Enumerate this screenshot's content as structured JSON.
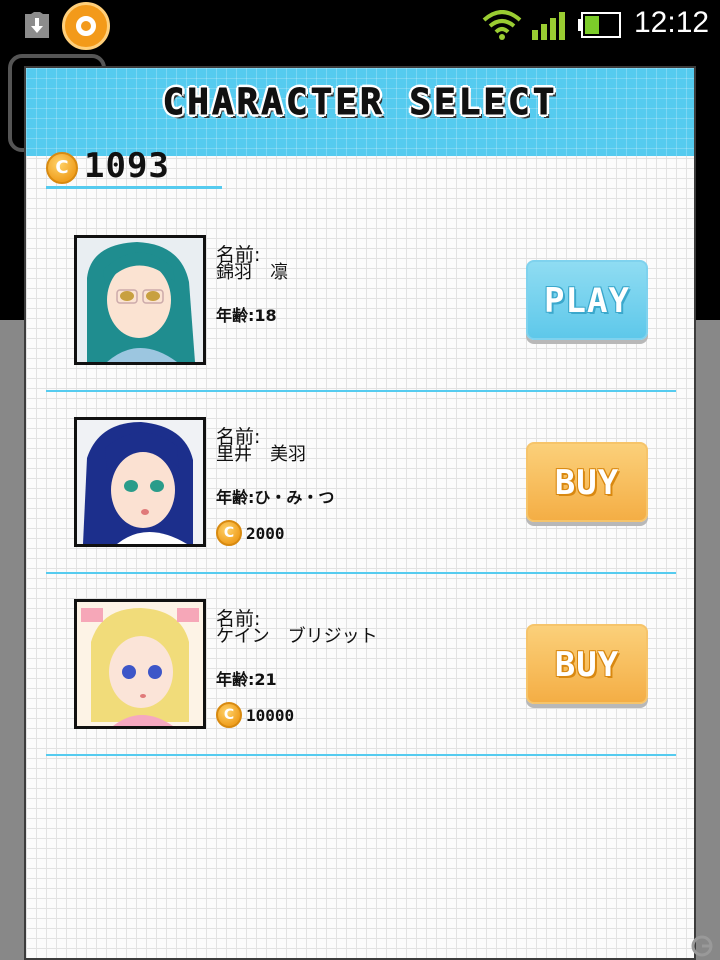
{
  "status_bar": {
    "time": "12:12",
    "icons": [
      "download-icon",
      "app-notification-icon",
      "wifi-icon",
      "signal-icon",
      "battery-icon"
    ]
  },
  "dialog": {
    "title": "CHARACTER SELECT",
    "coin_balance": "1093",
    "characters": [
      {
        "name_label": "名前:",
        "name": "錦羽　凛",
        "age": "年齢:18",
        "price": "",
        "button": "PLAY",
        "button_state": "play"
      },
      {
        "name_label": "名前:",
        "name": "里井　美羽",
        "age": "年齢:ひ・み・つ",
        "price": "2000",
        "button": "BUY",
        "button_state": "buy"
      },
      {
        "name_label": "名前:",
        "name": "ケイン　ブリジット",
        "age": "年齢:21",
        "price": "10000",
        "button": "BUY",
        "button_state": "buy"
      }
    ]
  },
  "colors": {
    "header": "#55cbef",
    "divider": "#55cbef",
    "play_button": "#5ec8ea",
    "buy_button": "#f4ae45",
    "coin": "#f0a020"
  }
}
